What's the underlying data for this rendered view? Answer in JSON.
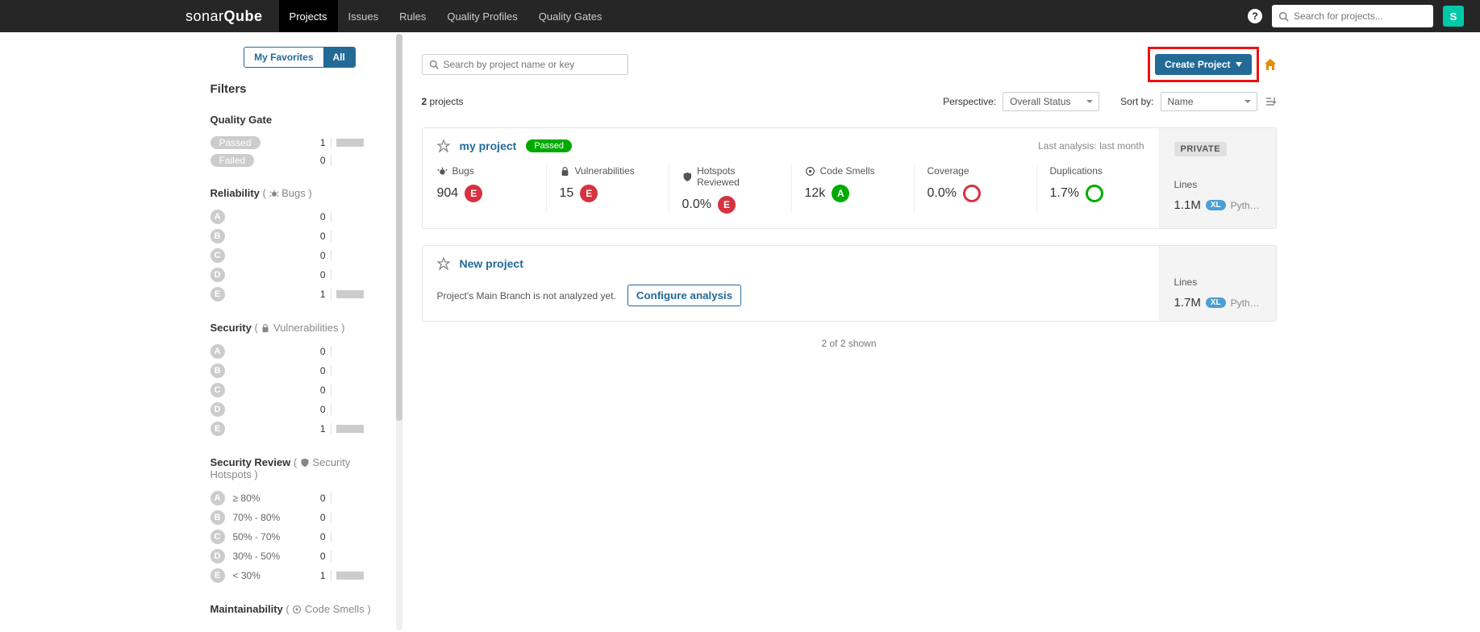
{
  "brand": {
    "a": "sonar",
    "b": "Qube"
  },
  "nav": [
    "Projects",
    "Issues",
    "Rules",
    "Quality Profiles",
    "Quality Gates"
  ],
  "active_nav": 0,
  "global_search_placeholder": "Search for projects...",
  "avatar_initial": "S",
  "sidebar_tabs": {
    "favorites": "My Favorites",
    "all": "All"
  },
  "filters_title": "Filters",
  "quality_gate": {
    "title": "Quality Gate",
    "passed_label": "Passed",
    "passed_count": "1",
    "failed_label": "Failed",
    "failed_count": "0"
  },
  "reliability": {
    "title": "Reliability",
    "sub": "Bugs",
    "rows": [
      {
        "r": "A",
        "c": "0",
        "bar": false
      },
      {
        "r": "B",
        "c": "0",
        "bar": false
      },
      {
        "r": "C",
        "c": "0",
        "bar": false
      },
      {
        "r": "D",
        "c": "0",
        "bar": false
      },
      {
        "r": "E",
        "c": "1",
        "bar": true
      }
    ]
  },
  "security": {
    "title": "Security",
    "sub": "Vulnerabilities",
    "rows": [
      {
        "r": "A",
        "c": "0",
        "bar": false
      },
      {
        "r": "B",
        "c": "0",
        "bar": false
      },
      {
        "r": "C",
        "c": "0",
        "bar": false
      },
      {
        "r": "D",
        "c": "0",
        "bar": false
      },
      {
        "r": "E",
        "c": "1",
        "bar": true
      }
    ]
  },
  "security_review": {
    "title": "Security Review",
    "sub": "Security Hotspots",
    "rows": [
      {
        "r": "A",
        "lbl": "≥ 80%",
        "c": "0",
        "bar": false
      },
      {
        "r": "B",
        "lbl": "70% - 80%",
        "c": "0",
        "bar": false
      },
      {
        "r": "C",
        "lbl": "50% - 70%",
        "c": "0",
        "bar": false
      },
      {
        "r": "D",
        "lbl": "30% - 50%",
        "c": "0",
        "bar": false
      },
      {
        "r": "E",
        "lbl": "< 30%",
        "c": "1",
        "bar": true
      }
    ]
  },
  "maintainability": {
    "title": "Maintainability",
    "sub": "Code Smells"
  },
  "project_search_placeholder": "Search by project name or key",
  "create_project_label": "Create Project",
  "projects_count_num": "2",
  "projects_count_text": "projects",
  "perspective_label": "Perspective:",
  "perspective_value": "Overall Status",
  "sortby_label": "Sort by:",
  "sortby_value": "Name",
  "project1": {
    "name": "my project",
    "badge": "Passed",
    "last_analysis": "Last analysis: last month",
    "visibility": "PRIVATE",
    "metrics": {
      "bugs": {
        "label": "Bugs",
        "value": "904",
        "rating": "E"
      },
      "vuln": {
        "label": "Vulnerabilities",
        "value": "15",
        "rating": "E"
      },
      "hotspots": {
        "label": "Hotspots Reviewed",
        "value": "0.0%",
        "rating": "E"
      },
      "smells": {
        "label": "Code Smells",
        "value": "12k",
        "rating": "A"
      },
      "coverage": {
        "label": "Coverage",
        "value": "0.0%"
      },
      "dup": {
        "label": "Duplications",
        "value": "1.7%"
      }
    },
    "lines": {
      "label": "Lines",
      "value": "1.1M",
      "size": "XL",
      "lang": "Python, ..."
    }
  },
  "project2": {
    "name": "New project",
    "not_analyzed": "Project's Main Branch is not analyzed yet.",
    "configure": "Configure analysis",
    "lines": {
      "label": "Lines",
      "value": "1.7M",
      "size": "XL",
      "lang": "Python, ..."
    }
  },
  "footer": "2 of 2 shown"
}
